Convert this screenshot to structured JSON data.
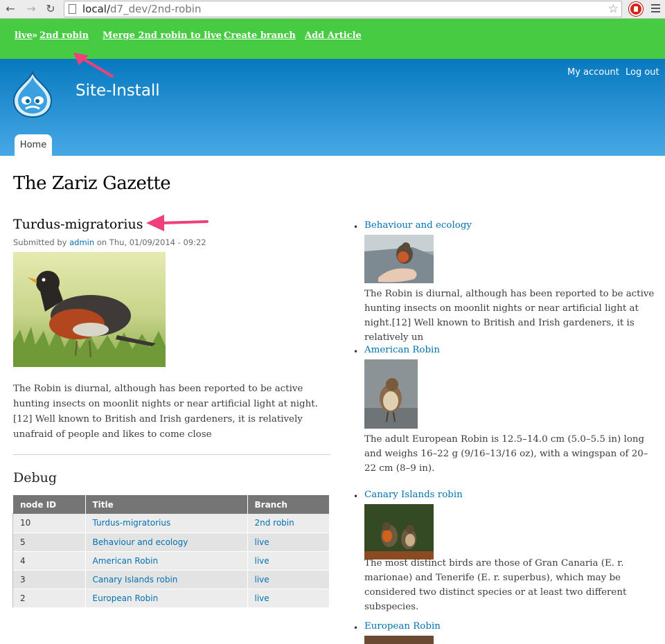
{
  "browser": {
    "url_host": "local/",
    "url_path": "d7_dev/2nd-robin"
  },
  "toolbar": {
    "crumb_live": "live",
    "crumb_sep": "»",
    "crumb_branch": "2nd robin",
    "merge_link": "Merge 2nd robin to live",
    "create_branch_link": "Create branch",
    "add_article_link": "Add Article",
    "bg_color": "#46cb42"
  },
  "header": {
    "site_name": "Site-Install",
    "my_account": "My account",
    "log_out": "Log out",
    "tab_home": "Home"
  },
  "main": {
    "page_title": "The Zariz Gazette",
    "node_title": "Turdus-migratorius",
    "submitted_prefix": "Submitted by",
    "author": "admin",
    "submitted_date": "on Thu, 01/09/2014 - 09:22",
    "body": "The Robin is diurnal, although has been reported to be active hunting insects on moonlit nights or near artificial light at night.[12] Well known to British and Irish gardeners, it is relatively unafraid of people and likes to come close",
    "debug_title": "Debug"
  },
  "debug_table": {
    "headers": [
      "node ID",
      "Title",
      "Branch"
    ],
    "rows": [
      {
        "nid": "10",
        "title": "Turdus-migratorius",
        "branch": "2nd robin"
      },
      {
        "nid": "5",
        "title": "Behaviour and ecology",
        "branch": "live"
      },
      {
        "nid": "4",
        "title": "American Robin",
        "branch": "live"
      },
      {
        "nid": "3",
        "title": "Canary Islands robin",
        "branch": "live"
      },
      {
        "nid": "2",
        "title": "European Robin",
        "branch": "live"
      }
    ]
  },
  "sidebar": {
    "items": [
      {
        "title": "Behaviour and ecology",
        "text": "The Robin is diurnal, although has been reported to be active hunting insects on moonlit nights or near artificial light at night.[12] Well known to British and Irish gardeners, it is relatively un"
      },
      {
        "title": "American Robin",
        "text": "The adult European Robin is 12.5–14.0 cm (5.0–5.5 in) long and weighs 16–22 g (9/16–13/16 oz), with a wingspan of 20–22 cm (8–9 in)."
      },
      {
        "title": "Canary Islands robin",
        "text": "The most distinct birds are those of Gran Canaria (E. r. marionae) and Tenerife (E. r. superbus), which may be considered two distinct species or at least two different subspecies."
      },
      {
        "title": "European Robin",
        "text": ""
      }
    ]
  }
}
